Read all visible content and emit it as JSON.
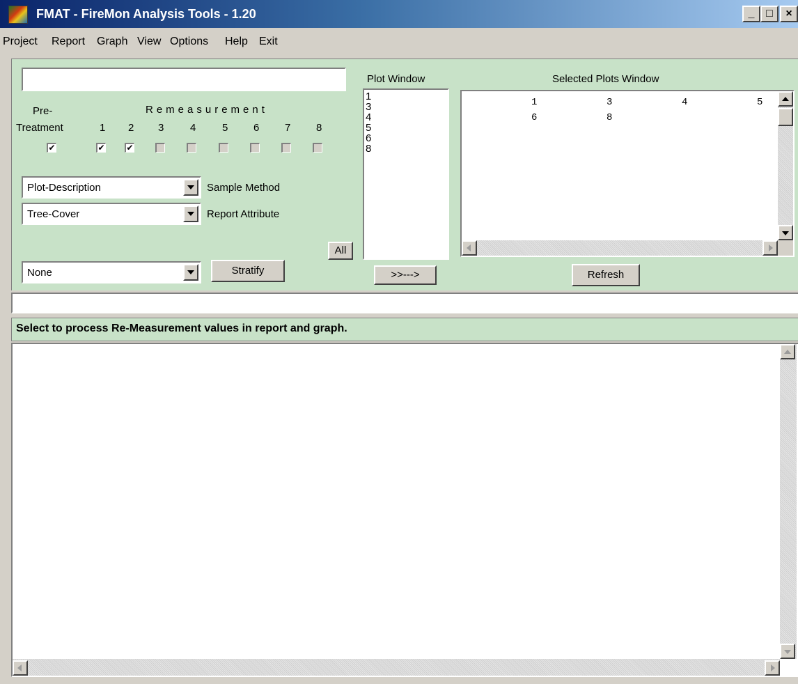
{
  "window": {
    "title": "FMAT - FireMon Analysis Tools  - 1.20",
    "controls": {
      "minimize": "_",
      "maximize": "□",
      "close": "×"
    }
  },
  "menu": [
    "Project",
    "Report",
    "Graph",
    "View",
    "Options",
    "Help",
    "Exit"
  ],
  "project_field": {
    "value": ""
  },
  "measurement": {
    "pre_label_line1": "Pre-",
    "pre_label_line2": "Treatment",
    "remeasurement_label": "Remeasurement",
    "numbers": [
      "1",
      "2",
      "3",
      "4",
      "5",
      "6",
      "7",
      "8"
    ],
    "pre_checked": true,
    "checked": [
      true,
      true,
      false,
      false,
      false,
      false,
      false,
      false
    ]
  },
  "sample_method": {
    "value": "Plot-Description",
    "label": "Sample Method"
  },
  "report_attribute": {
    "value": "Tree-Cover",
    "label": "Report Attribute"
  },
  "stratify": {
    "value": "None",
    "button_label": "Stratify"
  },
  "all_button": "All",
  "plot_window": {
    "label": "Plot Window",
    "items": [
      "1",
      "3",
      "4",
      "5",
      "6",
      "8"
    ]
  },
  "transfer_button": ">>--->",
  "selected_plots": {
    "label": "Selected Plots Window",
    "rows": [
      [
        "1",
        "3",
        "4",
        "5"
      ],
      [
        "6",
        "8",
        "",
        ""
      ]
    ]
  },
  "refresh_button": "Refresh",
  "message_field": {
    "value": ""
  },
  "status_text": "Select to process Re-Measurement values in report and graph.",
  "output_area": {
    "value": ""
  },
  "colors": {
    "panel": "#c8e2c8",
    "chrome": "#d4d0c8",
    "title_start": "#0a246a",
    "title_end": "#a6caf0"
  },
  "icons": [
    "app-icon",
    "minimize-icon",
    "maximize-icon",
    "close-icon",
    "dropdown-arrow-icon",
    "scroll-up-icon",
    "scroll-down-icon",
    "scroll-left-icon",
    "scroll-right-icon",
    "checkmark-icon"
  ]
}
